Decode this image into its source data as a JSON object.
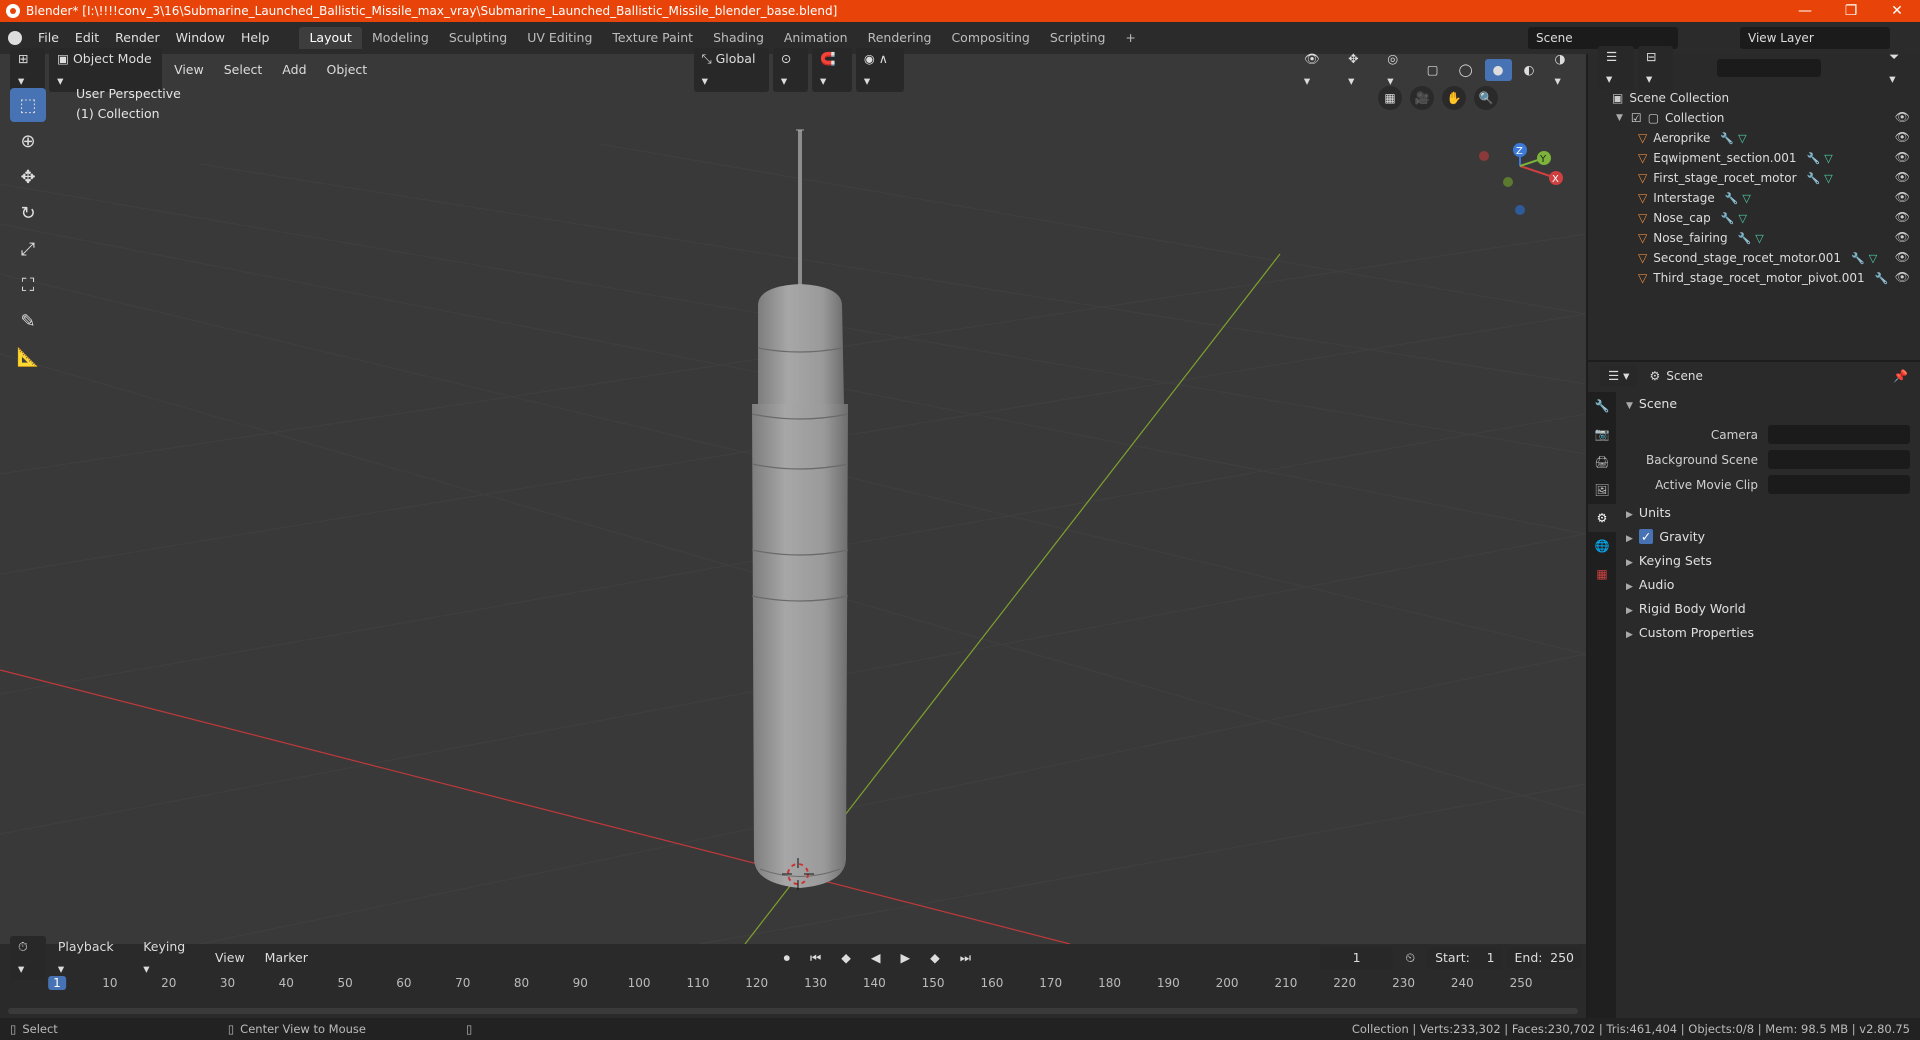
{
  "window": {
    "title": "Blender* [I:\\!!!!conv_3\\16\\Submarine_Launched_Ballistic_Missile_max_vray\\Submarine_Launched_Ballistic_Missile_blender_base.blend]",
    "minimize": "—",
    "maximize": "❐",
    "close": "✕"
  },
  "menu": [
    "File",
    "Edit",
    "Render",
    "Window",
    "Help"
  ],
  "workspaces": [
    "Layout",
    "Modeling",
    "Sculpting",
    "UV Editing",
    "Texture Paint",
    "Shading",
    "Animation",
    "Rendering",
    "Compositing",
    "Scripting"
  ],
  "add_workspace": "+",
  "scene_field": "Scene",
  "view_layer_field": "View Layer",
  "viewport": {
    "mode": "Object Mode",
    "menus": [
      "View",
      "Select",
      "Add",
      "Object"
    ],
    "transform": "Global",
    "perspective": "User Perspective",
    "collection": "(1) Collection",
    "gizmo": {
      "x": "X",
      "y": "Y",
      "z": "Z"
    }
  },
  "outliner": {
    "root": "Scene Collection",
    "collection": "Collection",
    "objects": [
      "Aeroprike",
      "Eqwipment_section.001",
      "First_stage_rocet_motor",
      "Interstage",
      "Nose_cap",
      "Nose_fairing",
      "Second_stage_rocet_motor.001",
      "Third_stage_rocet_motor_pivot.001"
    ]
  },
  "properties": {
    "context": "Scene",
    "panel": "Scene",
    "rows": [
      {
        "label": "Camera"
      },
      {
        "label": "Background Scene"
      },
      {
        "label": "Active Movie Clip"
      }
    ],
    "sections": [
      "Units",
      "Gravity",
      "Keying Sets",
      "Audio",
      "Rigid Body World",
      "Custom Properties"
    ]
  },
  "timeline": {
    "menus": [
      "Playback",
      "Keying",
      "View",
      "Marker"
    ],
    "current_frame": "1",
    "start_label": "Start:",
    "start": "1",
    "end_label": "End:",
    "end": "250",
    "ticks": [
      "1",
      "10",
      "20",
      "30",
      "40",
      "50",
      "60",
      "70",
      "80",
      "90",
      "100",
      "110",
      "120",
      "130",
      "140",
      "150",
      "160",
      "170",
      "180",
      "190",
      "200",
      "210",
      "220",
      "230",
      "240",
      "250"
    ]
  },
  "status": {
    "left": "Select",
    "middle": "Center View to Mouse",
    "right": "Collection | Verts:233,302 | Faces:230,702 | Tris:461,404 | Objects:0/8 | Mem: 98.5 MB | v2.80.75"
  },
  "colors": {
    "accent": "#4772b3",
    "titlebar": "#e8440a",
    "x_axis": "#c0393b",
    "y_axis": "#7da12e",
    "object_icon": "#e8883a"
  }
}
